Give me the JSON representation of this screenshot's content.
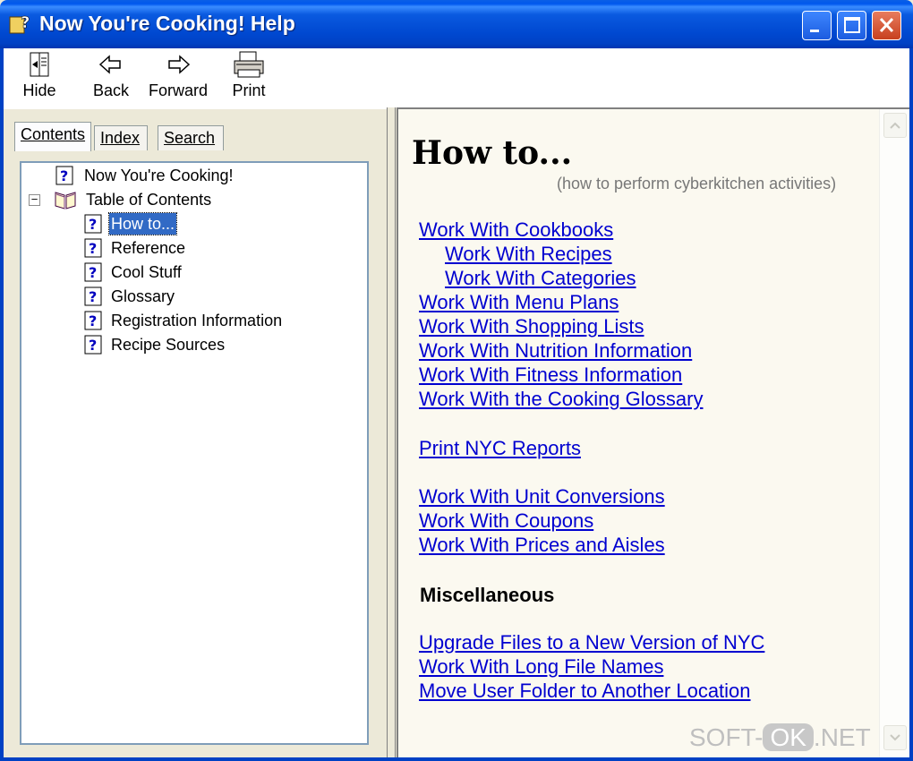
{
  "window": {
    "title": "Now You're Cooking! Help",
    "title_icon": "help-book-icon"
  },
  "toolbar": {
    "hide": "Hide",
    "back": "Back",
    "forward": "Forward",
    "print": "Print"
  },
  "tabs": {
    "contents": "Contents",
    "index": "Index",
    "search": "Search"
  },
  "tree": {
    "root": "Now You're Cooking!",
    "toc": "Table of Contents",
    "toc_expander": "−",
    "items": [
      "How to...",
      "Reference",
      "Cool Stuff",
      "Glossary",
      "Registration Information",
      "Recipe Sources"
    ],
    "selected": "How to..."
  },
  "content": {
    "heading": "How to...",
    "subtitle": "(how to perform cyberkitchen activities)",
    "links_group1": [
      "Work With Cookbooks",
      "Work With Recipes",
      "Work With Categories",
      "Work With Menu Plans",
      "Work With Shopping Lists",
      "Work With Nutrition Information",
      "Work With Fitness Information",
      "Work With the Cooking Glossary"
    ],
    "links_group2": [
      "Print NYC Reports"
    ],
    "links_group3": [
      "Work With Unit Conversions",
      "Work With Coupons",
      "Work With Prices and Aisles"
    ],
    "misc_heading": "Miscellaneous",
    "links_group4": [
      "Upgrade Files to a New Version of NYC",
      "Work With Long File Names",
      "Move User Folder to Another Location"
    ]
  },
  "watermark": {
    "left": "SOFT-",
    "mid": "OK",
    "right": ".NET"
  },
  "colors": {
    "titlebar": "#0048d0",
    "link": "#0000d0",
    "selection": "#316ac5",
    "content_bg": "#fbf9f0"
  }
}
